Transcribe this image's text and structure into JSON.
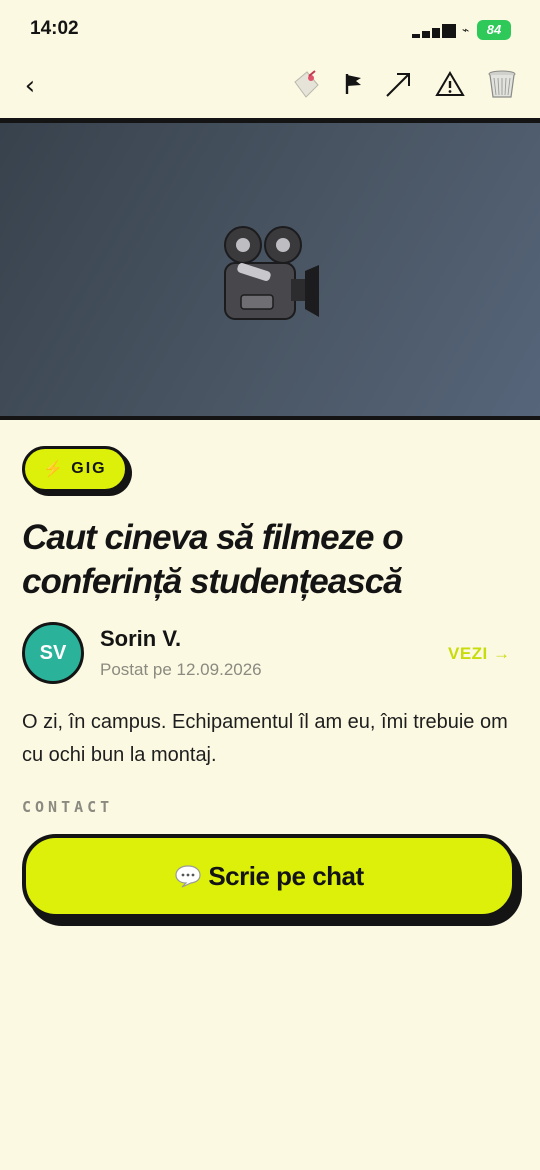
{
  "status_bar": {
    "time": "14:02",
    "battery": "84",
    "battery_color": "#2fc95a"
  },
  "toolbar": {
    "back_icon": "‹",
    "icons": [
      "tag-icon",
      "flag-icon",
      "share-arrow-icon",
      "warning-icon",
      "trash-icon"
    ]
  },
  "hero": {
    "icon": "movie-camera-icon",
    "background": "#4a5664"
  },
  "post": {
    "badge": "GIG",
    "badge_icon": "⚡",
    "title": "Caut cineva să filmeze o conferință studențească",
    "author": {
      "initials": "SV",
      "name": "Sorin V.",
      "posted": "Postat pe 12.09.2026",
      "avatar_color": "#2ab39a"
    },
    "view_link": "VEZI →",
    "body": "O zi, în campus. Echipamentul îl am eu, îmi trebuie om cu ochi bun la montaj."
  },
  "contact": {
    "label": "CONTACT",
    "chat_button": "Scrie pe chat",
    "chat_icon": "speech-bubble-icon"
  },
  "colors": {
    "accent": "#dcf00a",
    "background": "#fcf9e2",
    "ink": "#141414"
  }
}
